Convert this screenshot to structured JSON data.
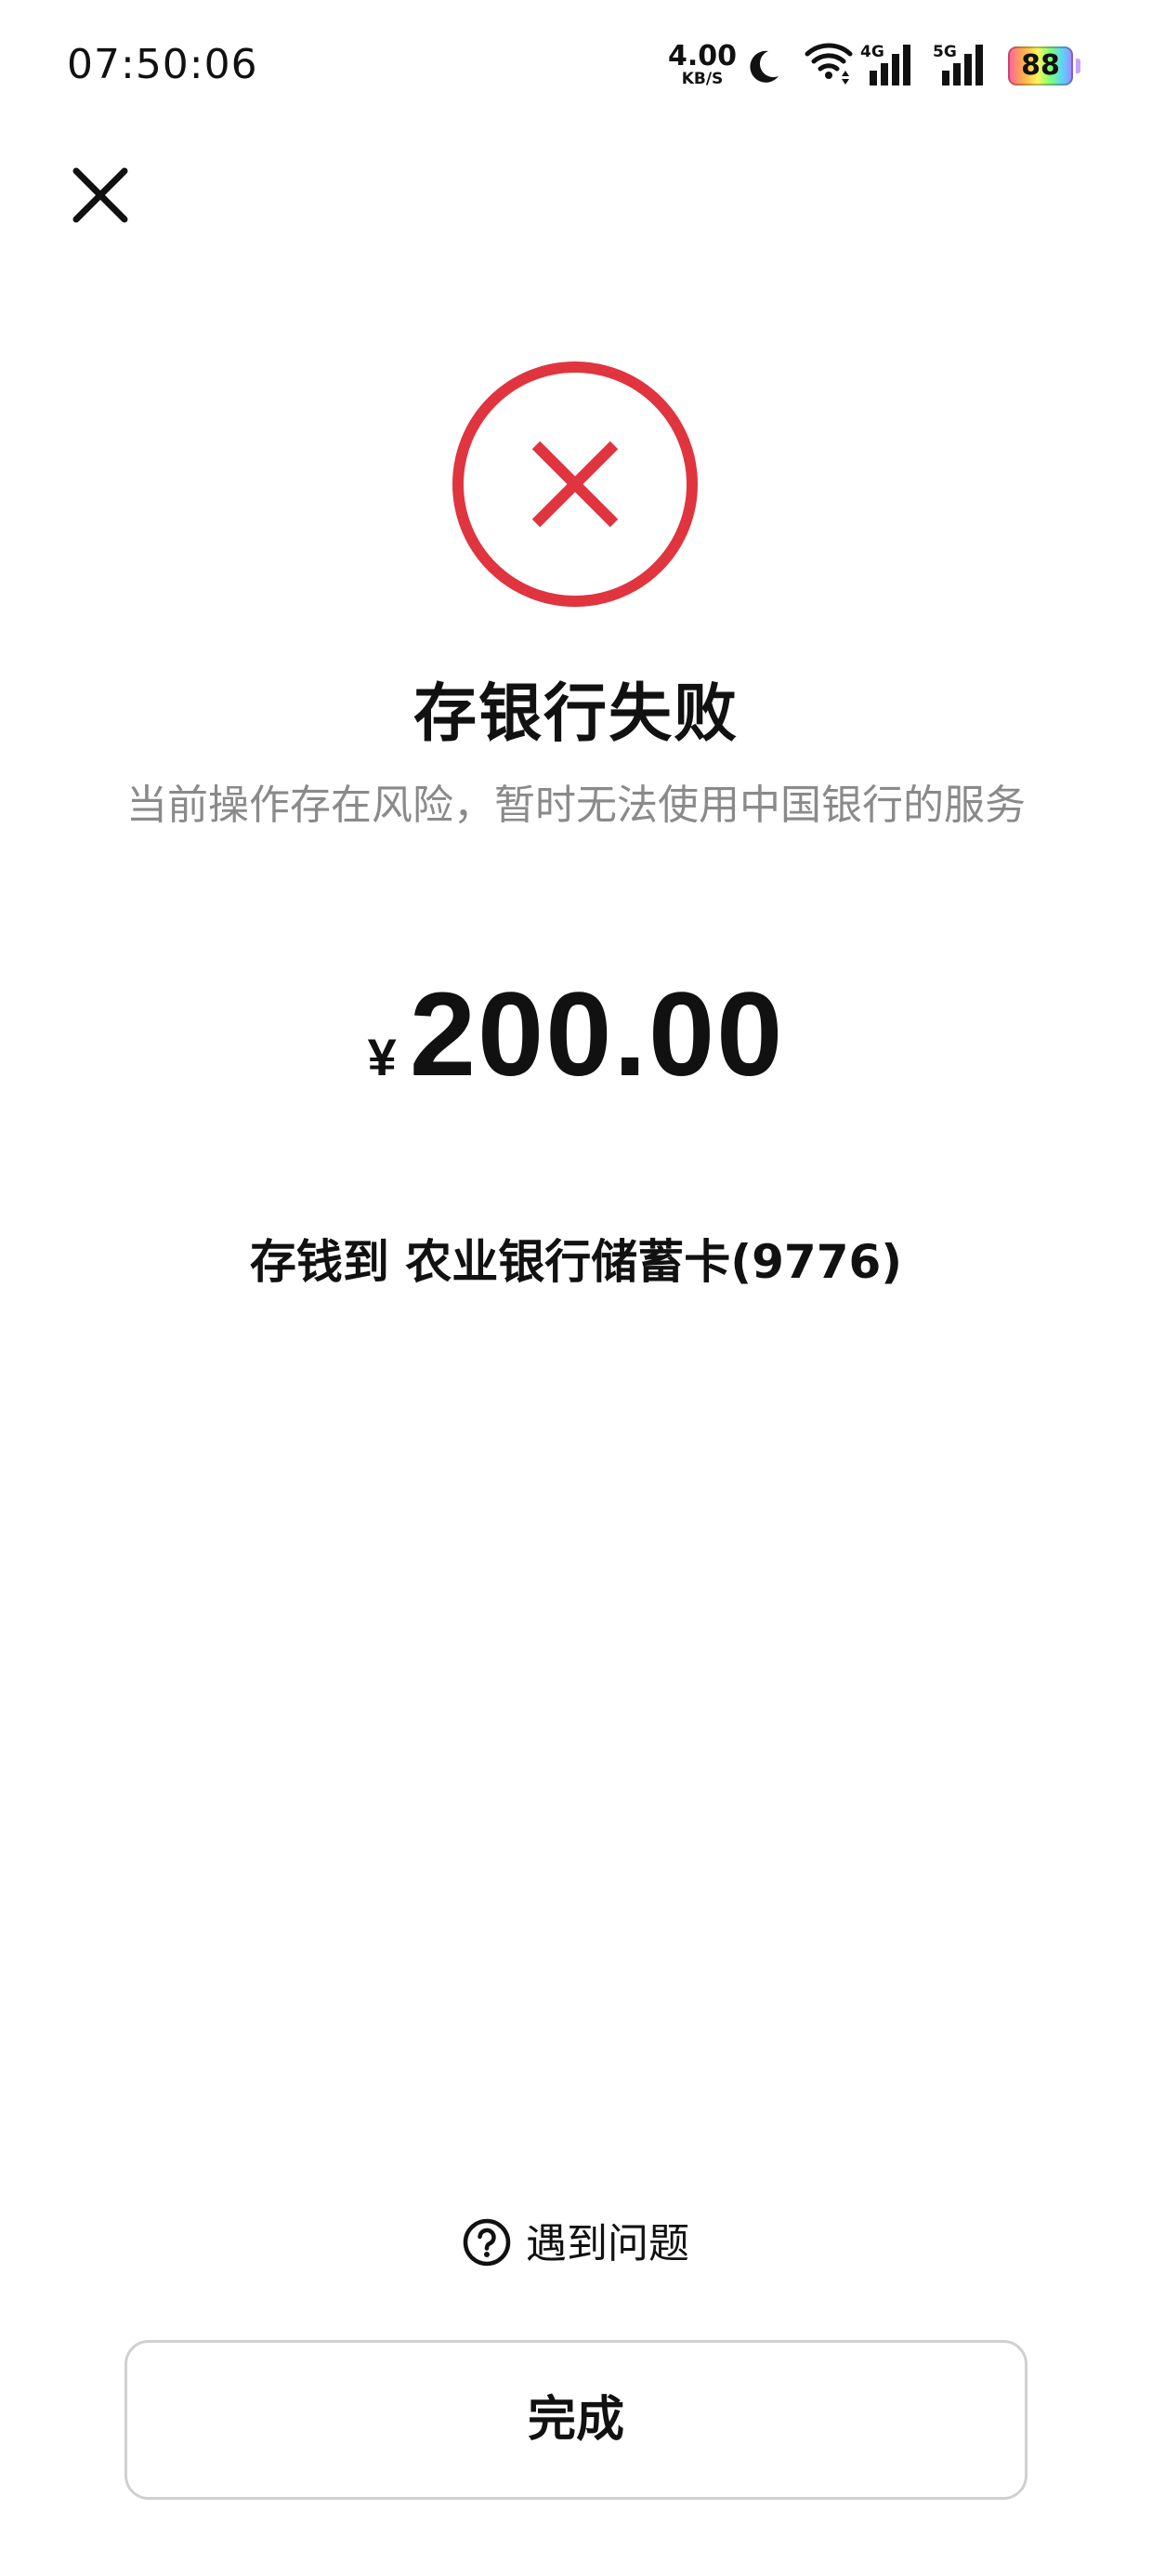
{
  "status_bar": {
    "time": "07:50:06",
    "net_speed_value": "4.00",
    "net_speed_unit": "KB/S",
    "signal_1_label": "4G",
    "signal_2_label": "5G",
    "battery_level": "88",
    "icons": [
      "moon-icon",
      "wifi-icon",
      "signal-4g-icon",
      "signal-5g-icon",
      "battery-icon"
    ]
  },
  "nav": {
    "close_icon": "close-icon"
  },
  "result": {
    "status_icon": "fail-x-circle-icon",
    "status_color": "#e0343f",
    "title": "存银行失败",
    "subtitle": "当前操作存在风险，暂时无法使用中国银行的服务"
  },
  "amount": {
    "currency_symbol": "¥",
    "value": "200.00"
  },
  "destination": {
    "text": "存钱到 农业银行储蓄卡(9776)"
  },
  "help": {
    "icon": "question-circle-icon",
    "label": "遇到问题"
  },
  "done_button": {
    "label": "完成"
  }
}
